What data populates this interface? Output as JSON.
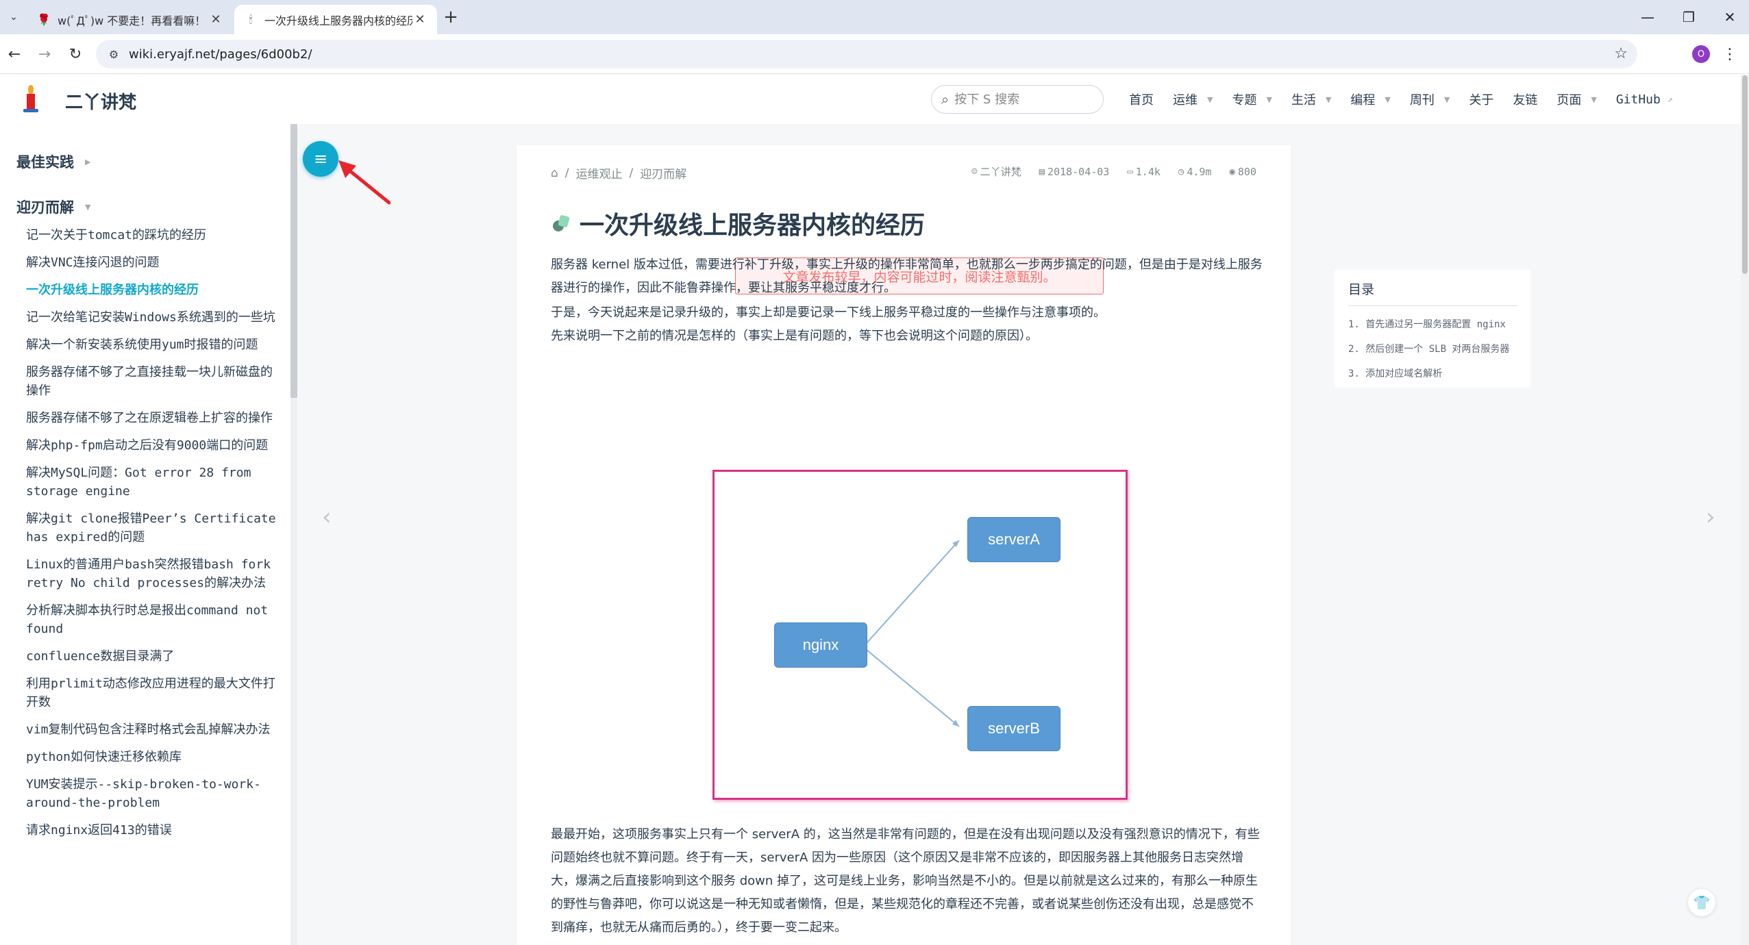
{
  "browser": {
    "tabs": [
      {
        "title": "w(ﾟДﾟ)w 不要走！再看看嘛！",
        "active": false
      },
      {
        "title": "一次升级线上服务器内核的经历",
        "active": true
      }
    ],
    "url": "wiki.eryajf.net/pages/6d00b2/",
    "profile_initial": "O"
  },
  "site": {
    "name": "二丫讲梵",
    "search_placeholder": "按下 S 搜索",
    "nav": [
      {
        "label": "首页",
        "dropdown": false
      },
      {
        "label": "运维",
        "dropdown": true
      },
      {
        "label": "专题",
        "dropdown": true
      },
      {
        "label": "生活",
        "dropdown": true
      },
      {
        "label": "编程",
        "dropdown": true
      },
      {
        "label": "周刊",
        "dropdown": true
      },
      {
        "label": "关于",
        "dropdown": false
      },
      {
        "label": "友链",
        "dropdown": false
      },
      {
        "label": "页面",
        "dropdown": true
      },
      {
        "label": "GitHub",
        "dropdown": false,
        "external": true
      }
    ]
  },
  "sidebar": {
    "groups": [
      {
        "title": "最佳实践",
        "expanded": false
      },
      {
        "title": "迎刃而解",
        "expanded": true
      }
    ],
    "items": [
      "记一次关于tomcat的踩坑的经历",
      "解决VNC连接闪退的问题",
      "一次升级线上服务器内核的经历",
      "记一次给笔记安装Windows系统遇到的一些坑",
      "解决一个新安装系统使用yum时报错的问题",
      "服务器存储不够了之直接挂载一块儿新磁盘的操作",
      "服务器存储不够了之在原逻辑卷上扩容的操作",
      "解决php-fpm启动之后没有9000端口的问题",
      "解决MySQL问题：Got error 28 from storage engine",
      "解决git clone报错Peer’s Certificate has expired的问题",
      "Linux的普通用户bash突然报错bash fork retry No child processes的解决办法",
      "分析解决脚本执行时总是报出command not found",
      "confluence数据目录满了",
      "利用prlimit动态修改应用进程的最大文件打开数",
      "vim复制代码包含注释时格式会乱掉解决办法",
      "python如何快速迁移依赖库",
      "YUM安装提示--skip-broken-to-work-around-the-problem",
      "请求nginx返回413的错误"
    ],
    "active_index": 2
  },
  "article": {
    "breadcrumb": [
      "运维观止",
      "迎刃而解"
    ],
    "meta": {
      "author": "二丫讲梵",
      "date": "2018-04-03",
      "words": "1.4k",
      "read_time": "4.9m",
      "views": "800"
    },
    "title": "一次升级线上服务器内核的经历",
    "warning": "文章发布较早，内容可能过时，阅读注意甄别。",
    "p1": "服务器 kernel 版本过低，需要进行补丁升级，事实上升级的操作非常简单，也就那么一步两步搞定的问题，但是由于是对线上服务器进行的操作，因此不能鲁莽操作，要让其服务平稳过度才行。",
    "p2": "于是，今天说起来是记录升级的，事实上却是要记录一下线上服务平稳过度的一些操作与注意事项的。",
    "p3": "先来说明一下之前的情况是怎样的（事实上是有问题的，等下也会说明这个问题的原因）。",
    "diagram": {
      "nodes": [
        "nginx",
        "serverA",
        "serverB"
      ]
    },
    "p4": "最最开始，这项服务事实上只有一个 serverA 的，这当然是非常有问题的，但是在没有出现问题以及没有强烈意识的情况下，有些问题始终也就不算问题。终于有一天，serverA 因为一些原因（这个原因又是非常不应该的，即因服务器上其他服务日志突然增大，爆满之后直接影响到这个服务 down 掉了，这可是线上业务，影响当然是不小的。但是以前就是这么过来的，有那么一种原生的野性与鲁莽吧，你可以说这是一种无知或者懒惰，但是，某些规范化的章程还不完善，或者说某些创伤还没有出现，总是感觉不到痛痒，也就无从痛而后勇的。），终于要一变二起来。"
  },
  "toc": {
    "title": "目录",
    "items": [
      "1.   首先通过另一服务器配置 nginx",
      "2.   然后创建一个 SLB 对两台服务器",
      "3. 添加对应域名解析"
    ]
  },
  "colors": {
    "accent": "#11a8cd",
    "warning": "#f56c6c",
    "node": "#5b9bd5",
    "diagram_border": "#d63384"
  }
}
